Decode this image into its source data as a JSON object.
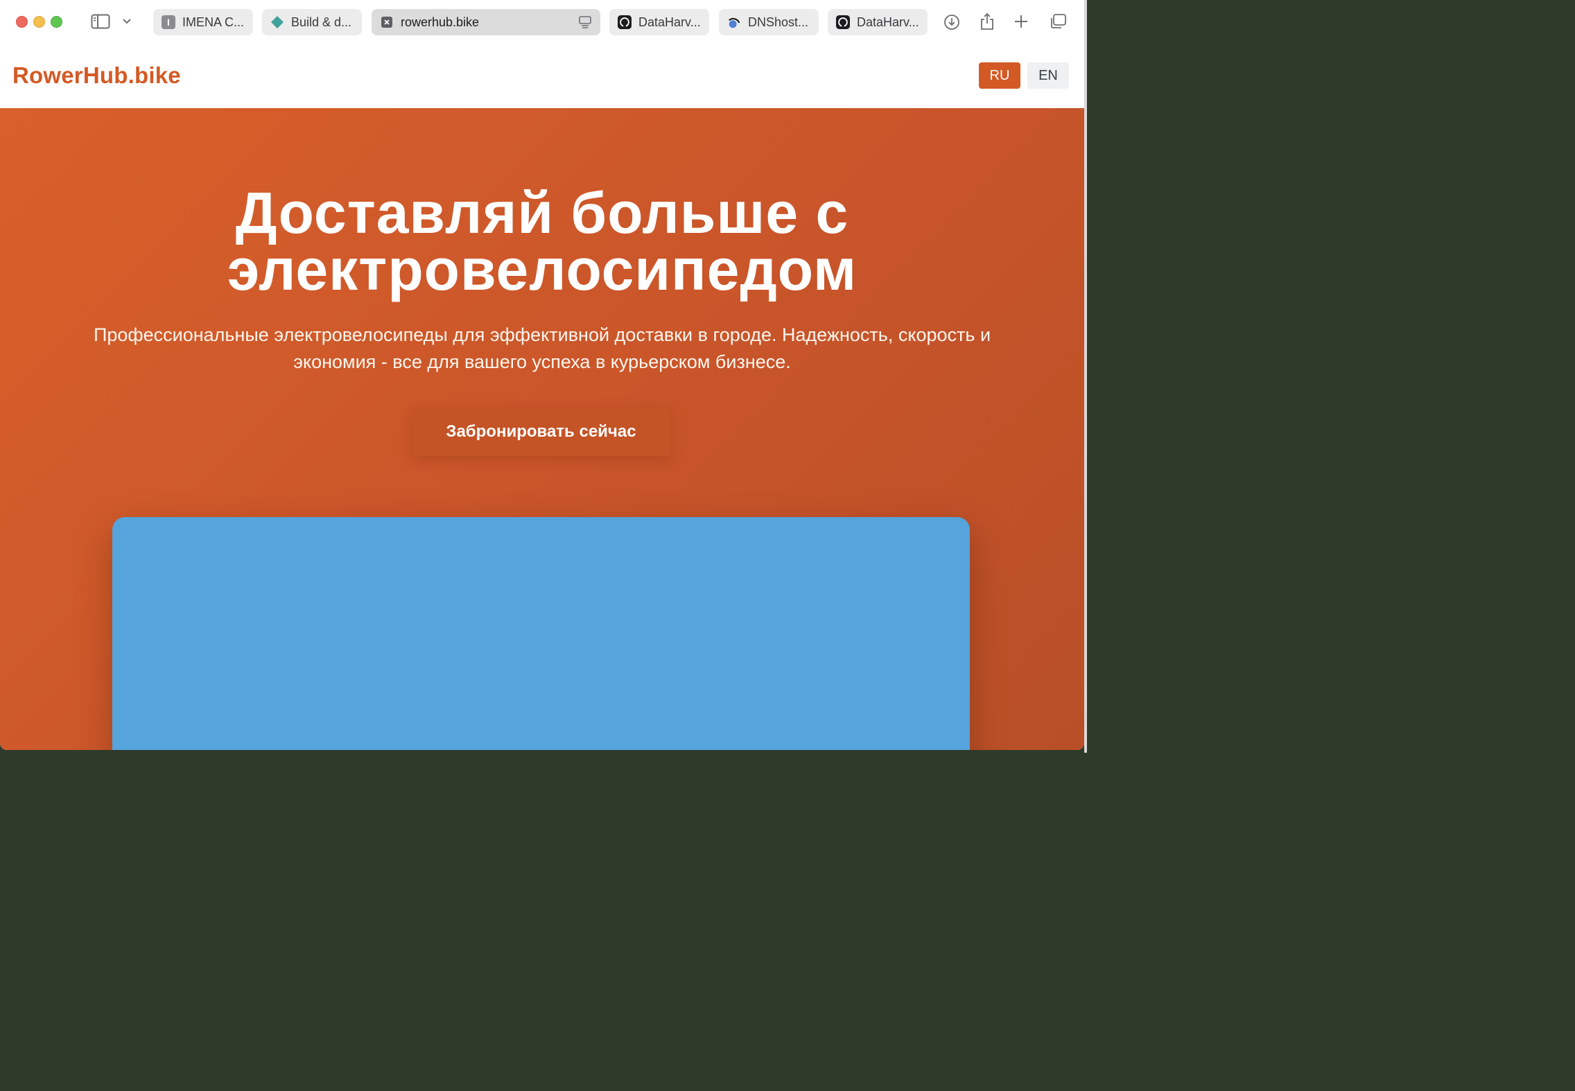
{
  "browser": {
    "tabs": [
      {
        "label": "IMENA C...",
        "icon": "imena-favicon"
      },
      {
        "label": "Build & d...",
        "icon": "diamond-favicon"
      },
      {
        "label": "rowerhub.bike",
        "icon": "close-tab-icon",
        "active": true
      },
      {
        "label": "DataHarv...",
        "icon": "github-favicon"
      },
      {
        "label": "DNShost...",
        "icon": "dnshost-favicon"
      },
      {
        "label": "DataHarv...",
        "icon": "github-favicon"
      }
    ],
    "imena_letter": "I"
  },
  "site": {
    "logo": "RowerHub.bike",
    "lang_ru": "RU",
    "lang_en": "EN",
    "accent_color": "#d35a24"
  },
  "hero": {
    "title_line1": "Доставляй больше с",
    "title_line2": "электровелосипедом",
    "subtitle_line1": "Профессиональные электровелосипеды для эффективной доставки в городе. Надежность, скорость и",
    "subtitle_line2": "экономия - все для вашего успеха в курьерском бизнесе.",
    "cta": "Забронировать сейчас",
    "background_color": "#cf5a27",
    "media_color": "#55a4dc"
  }
}
